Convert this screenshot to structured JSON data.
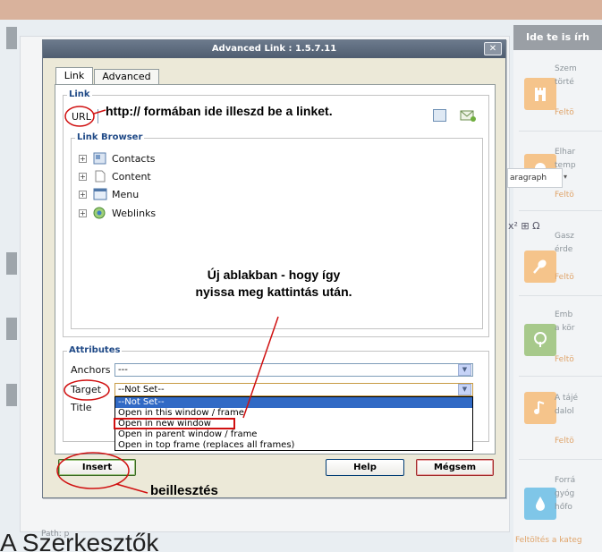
{
  "sidebar": {
    "heading": "Ide te is írh",
    "items": [
      {
        "icon": "castle-icon",
        "lines": [
          "Szem",
          "törté"
        ],
        "link": "Feltö"
      },
      {
        "icon": "tree-icon",
        "lines": [
          "Elhar",
          "temp"
        ],
        "link": "Feltö"
      },
      {
        "icon": "spoon-icon",
        "lines": [
          "Gasz",
          "érde"
        ],
        "link": "Feltö"
      },
      {
        "icon": "leaf-tree-icon",
        "lines": [
          "Emb",
          "a kör"
        ],
        "link": "Feltö"
      },
      {
        "icon": "music-note-icon",
        "lines": [
          "A tájé",
          "dalol"
        ],
        "link": "Feltö"
      },
      {
        "icon": "water-drop-icon",
        "lines": [
          "Forrá",
          "gyóg",
          "hőfo"
        ],
        "link": ""
      }
    ],
    "footer_link": "Feltöltés a kateg"
  },
  "editor": {
    "paragraph_select": "aragraph",
    "symbols": "x² ⊞ Ω",
    "path": "Path: p",
    "page_heading": "A Szerkesztők"
  },
  "dialog": {
    "title": "Advanced Link : 1.5.7.11",
    "close_label": "✕",
    "tabs": [
      "Link",
      "Advanced"
    ],
    "link_legend": "Link",
    "url_label": "URL",
    "url_value": "",
    "browser_legend": "Link Browser",
    "tree": [
      {
        "icon": "contacts-icon",
        "label": "Contacts"
      },
      {
        "icon": "content-icon",
        "label": "Content"
      },
      {
        "icon": "menu-icon",
        "label": "Menu"
      },
      {
        "icon": "weblinks-icon",
        "label": "Weblinks"
      }
    ],
    "attributes_legend": "Attributes",
    "anchors_label": "Anchors",
    "anchors_value": "---",
    "target_label": "Target",
    "target_value": "--Not Set--",
    "title_label": "Title",
    "target_options": [
      "--Not Set--",
      "Open in this window / frame",
      "Open in new window",
      "Open in parent window / frame",
      "Open in top frame (replaces all frames)"
    ],
    "insert_label": "Insert",
    "help_label": "Help",
    "cancel_label": "Mégsem"
  },
  "annotations": {
    "url_note": "http:// formában ide illeszd be a linket.",
    "new_window_note": "Új ablakban - hogy így nyissa meg kattintás után.",
    "insert_note": "beillesztés",
    "color": "#d01010"
  }
}
